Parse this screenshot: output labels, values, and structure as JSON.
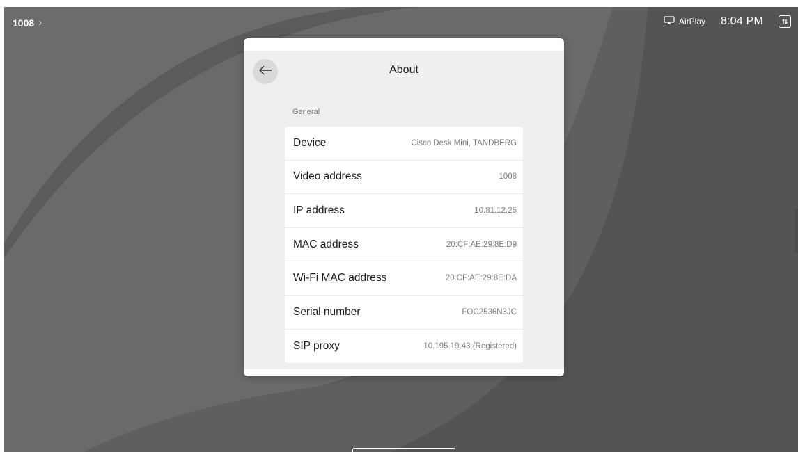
{
  "topbar": {
    "device_number": "1008",
    "chevron": "›",
    "airplay_label": "AirPlay",
    "time": "8:04 PM",
    "status_icon": "status-square-icon"
  },
  "modal": {
    "title": "About",
    "back_icon": "back-arrow-icon",
    "section_label": "General",
    "rows": [
      {
        "label": "Device",
        "value": "Cisco Desk Mini, TANDBERG"
      },
      {
        "label": "Video address",
        "value": "1008"
      },
      {
        "label": "IP address",
        "value": "10.81.12.25"
      },
      {
        "label": "MAC address",
        "value": "20:CF:AE:29:8E:D9"
      },
      {
        "label": "Wi-Fi MAC address",
        "value": "20:CF:AE:29:8E:DA"
      },
      {
        "label": "Serial number",
        "value": "FOC2536N3JC"
      },
      {
        "label": "SIP proxy",
        "value": "10.195.19.43 (Registered)"
      }
    ]
  },
  "colors": {
    "background": "#5a5a5a",
    "modal_bg": "#efefef",
    "card_bg": "#ffffff",
    "back_button_bg": "#d9d9d9"
  }
}
